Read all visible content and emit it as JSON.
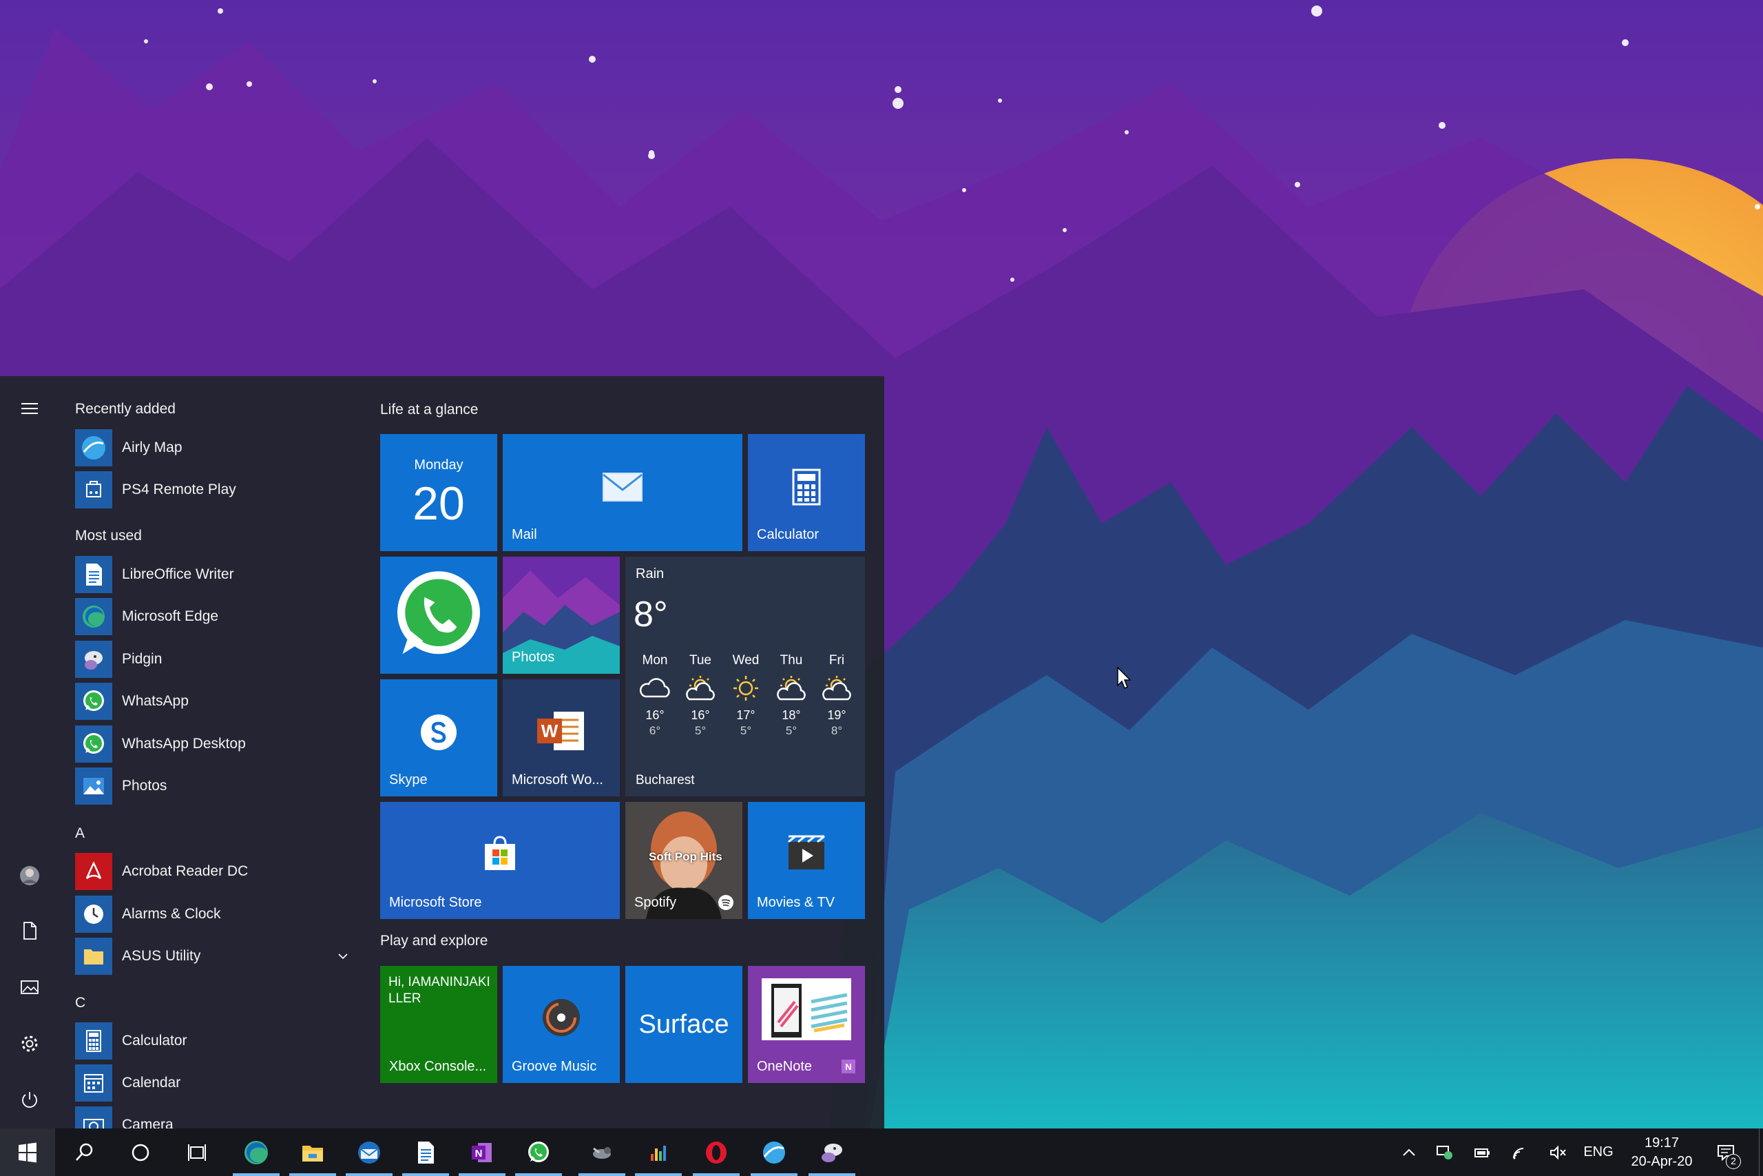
{
  "start_menu": {
    "recently_added": {
      "heading": "Recently added",
      "items": [
        {
          "label": "Airly Map",
          "icon": "airly-map-icon"
        },
        {
          "label": "PS4 Remote Play",
          "icon": "ps4-remote-play-icon"
        }
      ]
    },
    "most_used": {
      "heading": "Most used",
      "items": [
        {
          "label": "LibreOffice Writer",
          "icon": "libreoffice-writer-icon"
        },
        {
          "label": "Microsoft Edge",
          "icon": "edge-icon"
        },
        {
          "label": "Pidgin",
          "icon": "pidgin-icon"
        },
        {
          "label": "WhatsApp",
          "icon": "whatsapp-icon"
        },
        {
          "label": "WhatsApp Desktop",
          "icon": "whatsapp-icon"
        },
        {
          "label": "Photos",
          "icon": "photos-icon"
        }
      ]
    },
    "group_a": {
      "heading": "A",
      "items": [
        {
          "label": "Acrobat Reader DC",
          "icon": "acrobat-icon"
        },
        {
          "label": "Alarms & Clock",
          "icon": "alarm-clock-icon"
        },
        {
          "label": "ASUS Utility",
          "icon": "folder-icon"
        }
      ]
    },
    "group_c": {
      "heading": "C",
      "items": [
        {
          "label": "Calculator",
          "icon": "calculator-icon"
        },
        {
          "label": "Calendar",
          "icon": "calendar-icon"
        },
        {
          "label": "Camera",
          "icon": "camera-icon"
        }
      ]
    },
    "tiles": {
      "section1_title": "Life at a glance",
      "section2_title": "Play and explore",
      "calendar": {
        "weekday": "Monday",
        "day": "20"
      },
      "mail": "Mail",
      "calculator": "Calculator",
      "photos": "Photos",
      "skype": "Skype",
      "word": "Microsoft Wo...",
      "weather": {
        "condition": "Rain",
        "temp": "8°",
        "location": "Bucharest",
        "forecast": [
          {
            "day": "Mon",
            "icon": "cloud-icon",
            "hi": "16°",
            "lo": "6°"
          },
          {
            "day": "Tue",
            "icon": "partly-sunny-icon",
            "hi": "16°",
            "lo": "5°"
          },
          {
            "day": "Wed",
            "icon": "sun-icon",
            "hi": "17°",
            "lo": "5°"
          },
          {
            "day": "Thu",
            "icon": "partly-sunny-icon",
            "hi": "18°",
            "lo": "5°"
          },
          {
            "day": "Fri",
            "icon": "partly-sunny-icon",
            "hi": "19°",
            "lo": "8°"
          }
        ]
      },
      "store": "Microsoft Store",
      "spotify": "Spotify",
      "spotify_playlist": "Soft Pop Hits",
      "movies": "Movies & TV",
      "xbox_greeting": "Hi, IAMANINJAKILLER",
      "xbox": "Xbox Console...",
      "groove": "Groove Music",
      "surface": "Surface",
      "onenote": "OneNote"
    }
  },
  "taskbar": {
    "language": "ENG",
    "time": "19:17",
    "date": "20-Apr-20",
    "notification_count": "2"
  },
  "colors": {
    "tile_blue": "#0f72d2",
    "tile_dark": "#2a3448",
    "xbox_green": "#107c10",
    "onenote_purple": "#7e3aa8",
    "taskbar": "#15171c"
  }
}
